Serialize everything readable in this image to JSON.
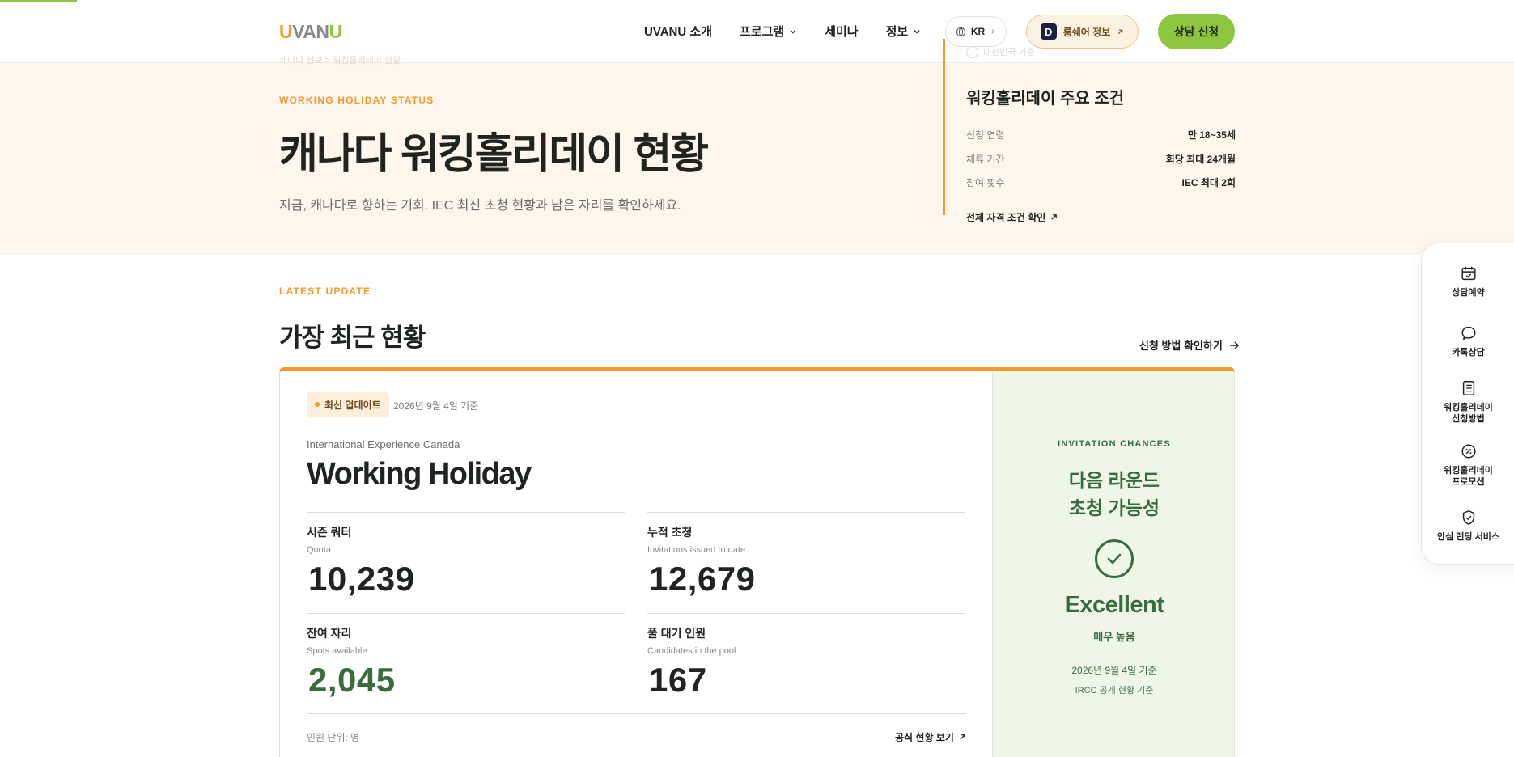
{
  "header": {
    "logo_part1": "U",
    "logo_part2": "VAN",
    "logo_part3": "U",
    "nav": [
      {
        "label": "UVANU 소개"
      },
      {
        "label": "프로그램"
      },
      {
        "label": "세미나"
      },
      {
        "label": "정보"
      }
    ],
    "lang": "KR",
    "roomshare_label": "룸쉐어 정보",
    "roomshare_logo": "D",
    "consult_label": "상담 신청"
  },
  "hero": {
    "breadcrumb": "캐나다 정보  >  워킹홀리데이 현황",
    "eyebrow": "WORKING HOLIDAY STATUS",
    "title": "캐나다 워킹홀리데이 현황",
    "subtitle": "지금, 캐나다로 향하는 기회. IEC 최신 초청 현황과 남은 자리를 확인하세요."
  },
  "conditions": {
    "faded": "대한민국 기준",
    "title": "워킹홀리데이 주요 조건",
    "rows": [
      {
        "key": "신청 연령",
        "value": "만 18~35세"
      },
      {
        "key": "체류 기간",
        "value": "회당 최대 24개월"
      },
      {
        "key": "참여 횟수",
        "value": "IEC 최대 2회"
      }
    ],
    "link": "전체 자격 조건 확인"
  },
  "latest": {
    "eyebrow": "LATEST UPDATE",
    "title": "가장 최근 현황",
    "apply_link": "신청 방법 확인하기"
  },
  "card": {
    "badge": "최신 업데이트",
    "date": "2026년 9월 4일 기준",
    "subtitle": "International Experience Canada",
    "title": "Working Holiday",
    "stats": [
      {
        "label": "시즌 쿼터",
        "en": "Quota",
        "value": "10,239"
      },
      {
        "label": "누적 초청",
        "en": "Invitations issued to date",
        "value": "12,679"
      },
      {
        "label": "잔여 자리",
        "en": "Spots available",
        "value": "2,045"
      },
      {
        "label": "풀 대기 인원",
        "en": "Candidates in the pool",
        "value": "167"
      }
    ],
    "unit_note": "인원 단위: 명",
    "official_link": "공식 현황 보기"
  },
  "invitation": {
    "eyebrow": "INVITATION CHANCES",
    "title_line1": "다음 라운드",
    "title_line2": "초청 가능성",
    "level": "Excellent",
    "level_ko": "매우 높음",
    "date": "2026년 9월 4일 기준",
    "source": "IRCC 공개 현황 기준"
  },
  "quick_menu": [
    {
      "label": "상담예약",
      "icon": "calendar-check-icon"
    },
    {
      "label": "카톡상담",
      "icon": "chat-bubble-icon"
    },
    {
      "label": "워킹홀리데이\n신청방법",
      "icon": "notebook-list-icon"
    },
    {
      "label": "워킹홀리데이\n프로모션",
      "icon": "discount-badge-icon"
    },
    {
      "label": "안심 랜딩 서비스",
      "icon": "shield-check-icon"
    }
  ],
  "colors": {
    "accent_orange": "#f29a2e",
    "accent_green": "#8cc63f",
    "dark_green": "#3a6b3e",
    "hero_bg": "#fef6ec",
    "chance_bg": "#eef6e6"
  }
}
